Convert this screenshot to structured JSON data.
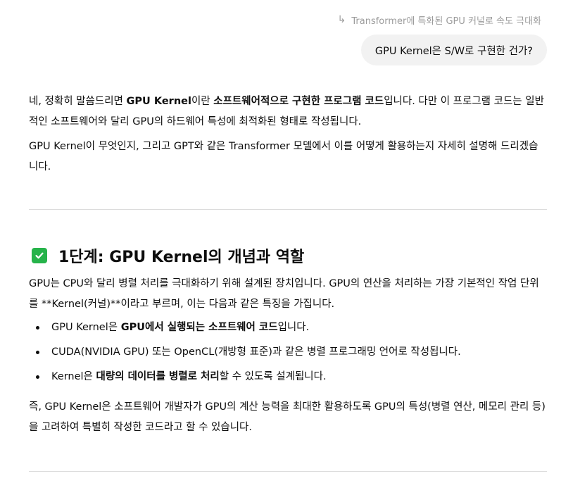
{
  "reply_reference": {
    "arrow_icon": "reply-arrow-icon",
    "text": "Transformer에 특화된 GPU 커널로 속도 극대화"
  },
  "user_message": {
    "text": "GPU Kernel은 S/W로 구현한 건가?"
  },
  "answer": {
    "intro": {
      "t1": "네, 정확히 말씀드리면 ",
      "b1": "GPU Kernel",
      "t2": "이란 ",
      "b2": "소프트웨어적으로 구현한 프로그램 코드",
      "t3": "입니다. 다만 이 프로그램 코드는 일반적인 소프트웨어와 달리 GPU의 하드웨어 특성에 최적화된 형태로 작성됩니다."
    },
    "intro2": "GPU Kernel이 무엇인지, 그리고 GPT와 같은 Transformer 모델에서 이를 어떻게 활용하는지 자세히 설명해 드리겠습니다.",
    "section1": {
      "icon": "check-mark-icon",
      "icon_color": "#26b34a",
      "heading": "1단계: GPU Kernel의 개념과 역할",
      "para": "GPU는 CPU와 달리 병렬 처리를 극대화하기 위해 설계된 장치입니다. GPU의 연산을 처리하는 가장 기본적인 작업 단위를 **Kernel(커널)**이라고 부르며, 이는 다음과 같은 특징을 가집니다.",
      "bullets": [
        {
          "t1": "GPU Kernel은 ",
          "b": "GPU에서 실행되는 소프트웨어 코드",
          "t2": "입니다."
        },
        {
          "t1": "CUDA(NVIDIA GPU) 또는 OpenCL(개방형 표준)과 같은 병렬 프로그래밍 언어로 작성됩니다.",
          "b": "",
          "t2": ""
        },
        {
          "t1": "Kernel은 ",
          "b": "대량의 데이터를 병렬로 처리",
          "t2": "할 수 있도록 설계됩니다."
        }
      ],
      "summary": "즉, GPU Kernel은 소프트웨어 개발자가 GPU의 계산 능력을 최대한 활용하도록 GPU의 특성(병렬 연산, 메모리 관리 등)을 고려하여 특별히 작성한 코드라고 할 수 있습니다."
    }
  },
  "colors": {
    "text": "#0d0d0d",
    "muted": "#9b9b9b",
    "bubble_bg": "#f2f2f2",
    "divider": "#dcdcdc",
    "check_green": "#26b34a"
  }
}
